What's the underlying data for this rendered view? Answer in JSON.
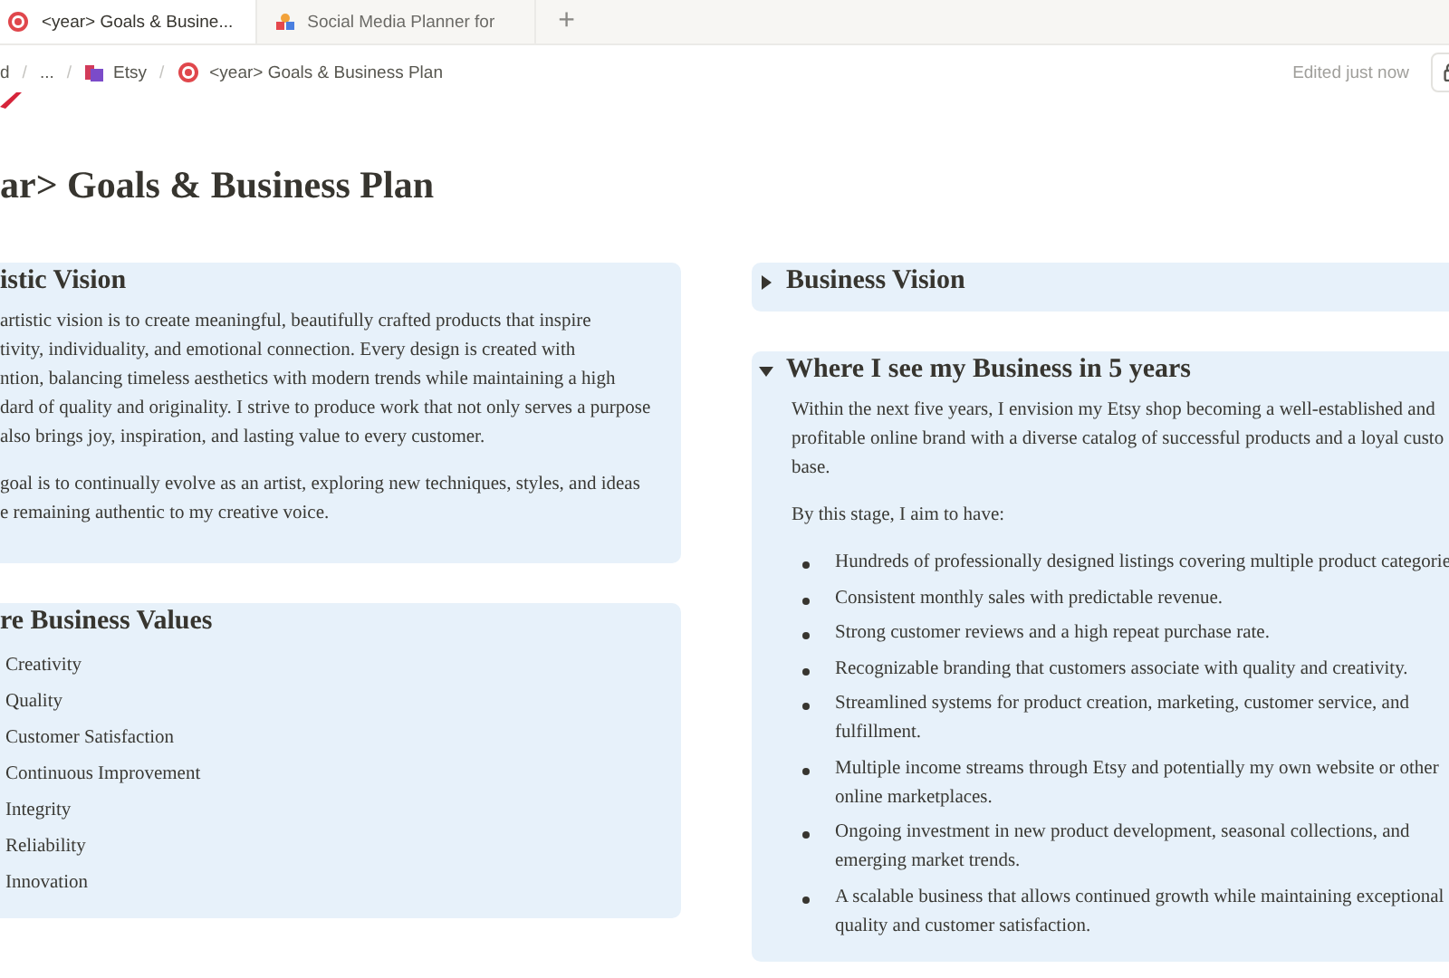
{
  "tabs": [
    {
      "label": "<year> Goals & Busine...",
      "selected": true
    },
    {
      "label": "Social Media Planner for",
      "selected": false
    }
  ],
  "new_tab": "+",
  "breadcrumb": [
    {
      "kind": "link",
      "text": "d"
    },
    {
      "kind": "separator",
      "text": "/"
    },
    {
      "kind": "link",
      "text": "..."
    },
    {
      "kind": "separator",
      "text": "/"
    },
    {
      "kind": "folder",
      "text": "Etsy"
    },
    {
      "kind": "separator",
      "text": "/"
    },
    {
      "kind": "page",
      "text": "<year> Goals & Business Plan"
    }
  ],
  "edited": "Edited just now",
  "title": "ar> Goals & Business Plan",
  "left": [
    {
      "kind": "text",
      "heading": "istic Vision",
      "paragraphs": [
        [
          "artistic vision is to create meaningful, beautifully crafted products that inspire",
          "tivity, individuality, and emotional connection. Every design is created with",
          "ntion, balancing timeless aesthetics with modern trends while maintaining a high",
          "dard of quality and originality. I strive to produce work that not only serves a purpose",
          "also brings joy, inspiration, and lasting value to every customer."
        ],
        [
          "goal is to continually evolve as an artist, exploring new techniques, styles, and ideas",
          "e remaining authentic to my creative voice."
        ]
      ]
    },
    {
      "kind": "list",
      "heading": "re Business Values",
      "items": [
        "Creativity",
        "Quality",
        "Customer Satisfaction",
        "Continuous Improvement",
        "Integrity",
        "Reliability",
        "Innovation"
      ]
    }
  ],
  "right": [
    {
      "heading": "Business Vision",
      "expanded": false
    },
    {
      "heading": "Where I see my Business in 5 years",
      "expanded": true,
      "paragraphs": [
        [
          "Within the next five years, I envision my Etsy shop becoming a well-established and",
          "profitable online brand with a diverse catalog of successful products and a loyal custo",
          "base."
        ],
        [
          "By this stage, I aim to have:"
        ]
      ],
      "bullets": [
        [
          "Hundreds of professionally designed listings covering multiple product categorie"
        ],
        [
          "Consistent monthly sales with predictable revenue."
        ],
        [
          "Strong customer reviews and a high repeat purchase rate."
        ],
        [
          "Recognizable branding that customers associate with quality and creativity."
        ],
        [
          "Streamlined systems for product creation, marketing, customer service, and",
          "fulfillment."
        ],
        [
          "Multiple income streams through Etsy and potentially my own website or other",
          "online marketplaces."
        ],
        [
          "Ongoing investment in new product development, seasonal collections, and",
          "emerging market trends."
        ],
        [
          "A scalable business that allows continued growth while maintaining exceptional",
          "quality and customer satisfaction."
        ]
      ]
    }
  ]
}
